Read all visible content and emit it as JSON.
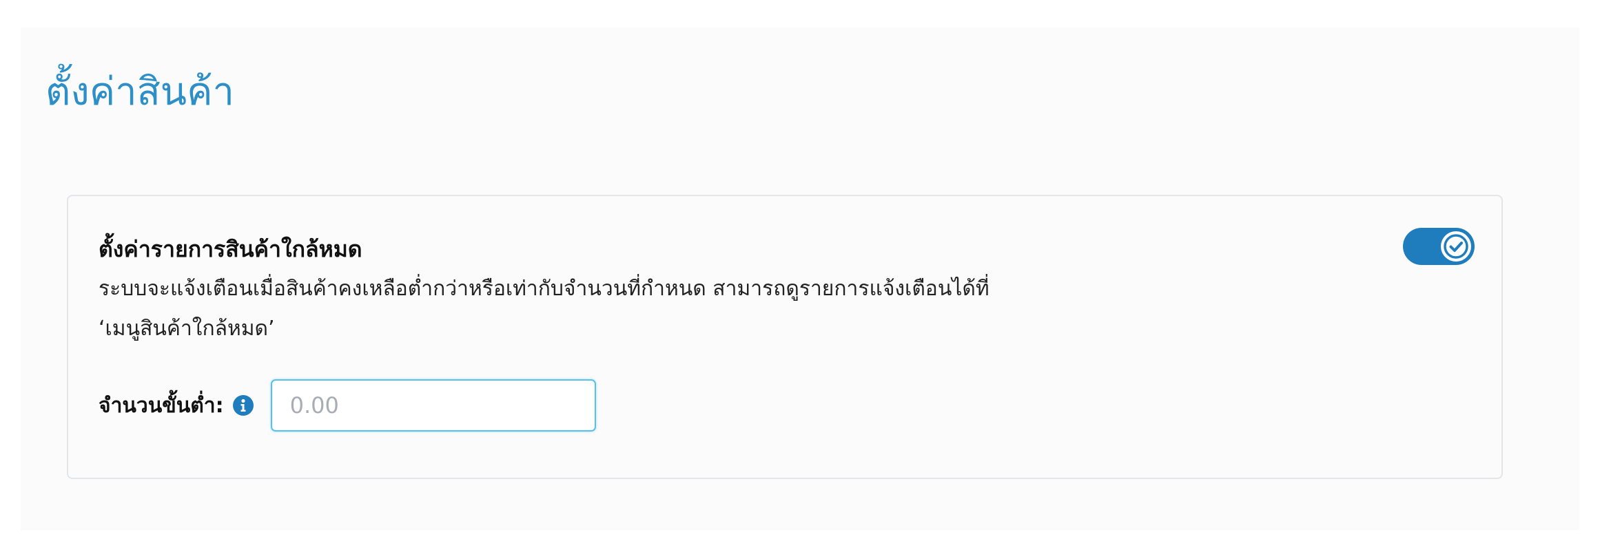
{
  "page": {
    "title": "ตั้งค่าสินค้า"
  },
  "low_stock_card": {
    "title": "ตั้งค่ารายการสินค้าใกล้หมด",
    "description_line1": "ระบบจะแจ้งเตือนเมื่อสินค้าคงเหลือต่ำกว่าหรือเท่ากับจำนวนที่กำหนด สามารถดูรายการแจ้งเตือนได้ที่",
    "description_line2": "‘เมนูสินค้าใกล้หมด’",
    "toggle": {
      "enabled": true,
      "icon": "check-icon"
    },
    "min_quantity": {
      "label": "จำนวนขั้นต่ำ:",
      "info_icon": "info-icon",
      "value": "",
      "placeholder": "0.00"
    }
  },
  "colors": {
    "title_blue": "#2d8fc7",
    "toggle_blue": "#1f7dbe",
    "input_focus_border": "#56c1ec",
    "card_border": "#e3e5e8",
    "panel_background": "#fbfbfc"
  }
}
